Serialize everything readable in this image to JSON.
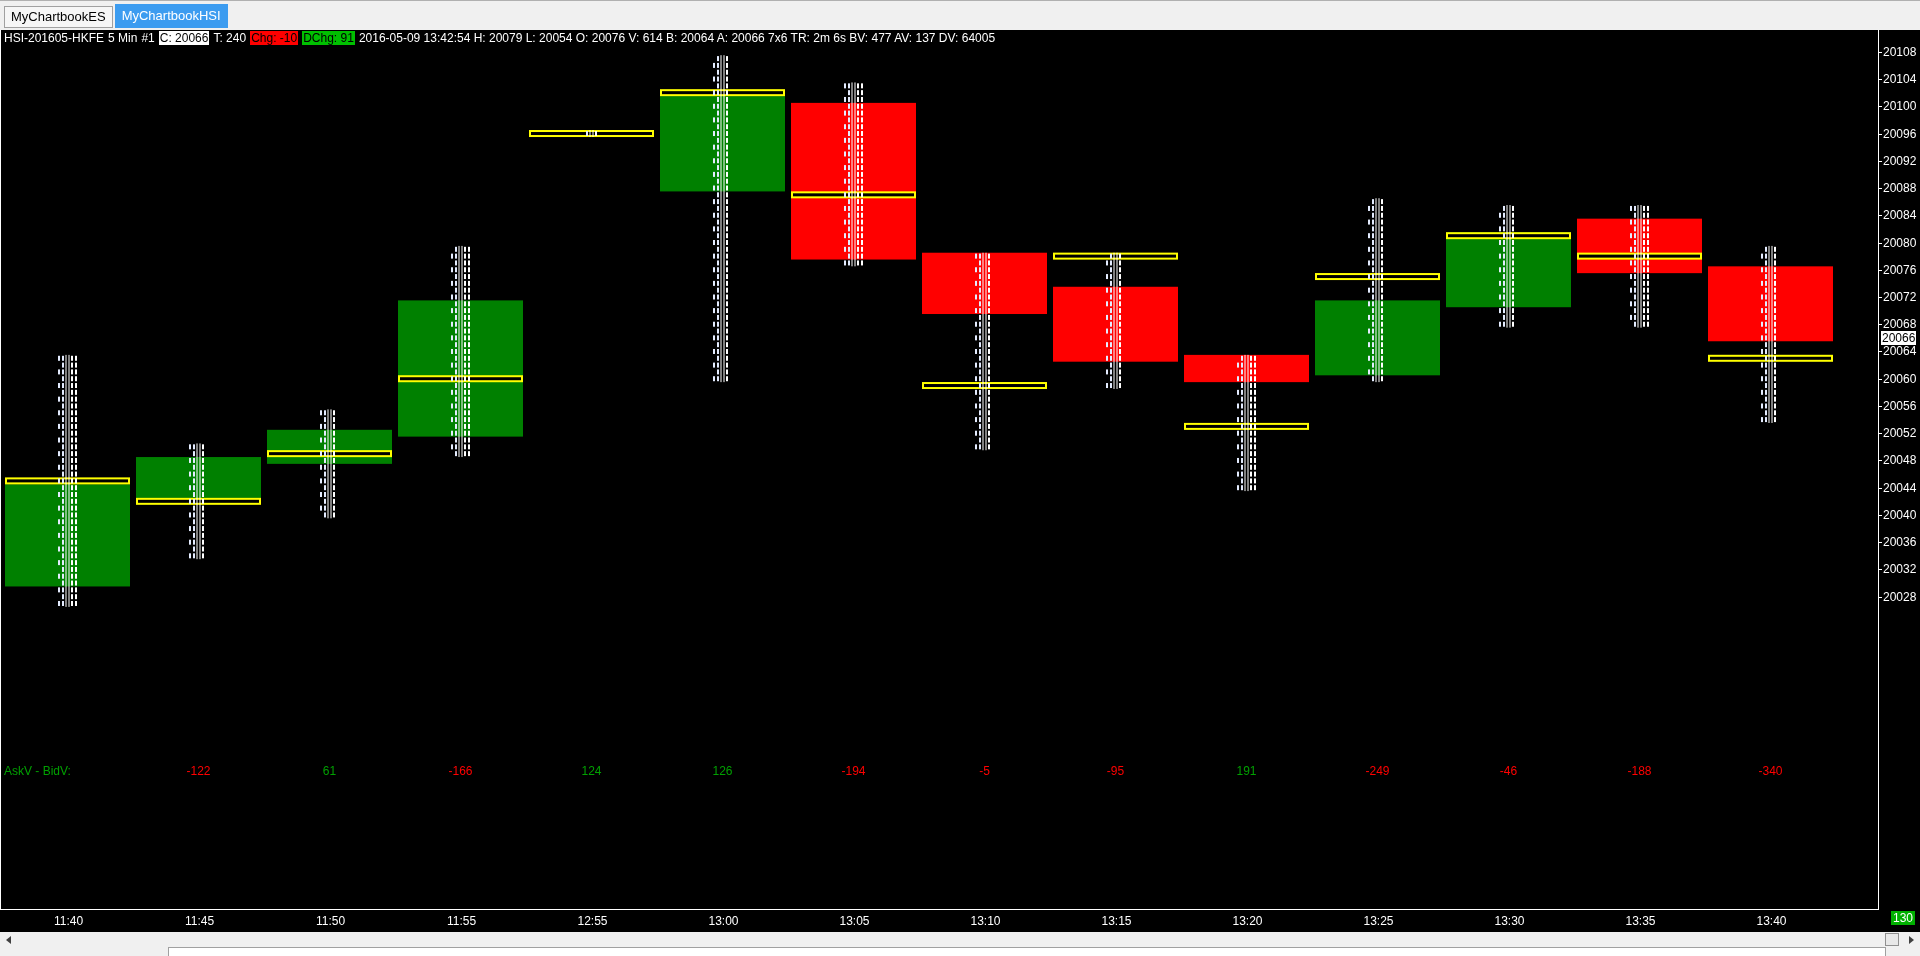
{
  "tabs": [
    {
      "label": "MyChartbookES",
      "selected": false
    },
    {
      "label": "MyChartbookHSI",
      "selected": true
    }
  ],
  "header": [
    {
      "text": "HSI-201605-HKFE"
    },
    {
      "text": "5 Min"
    },
    {
      "text": "#1"
    },
    {
      "text": "C: 20066",
      "color": "#ffffff"
    },
    {
      "text": "T: 240"
    },
    {
      "text": "Chg: -10",
      "color": "#ff0000"
    },
    {
      "text": "DChg: 91",
      "color": "#00c000"
    },
    {
      "text": "2016-05-09 13:42:54 H: 20079 L: 20054 O: 20076 V: 614 B: 20064 A: 20066 7x6 TR: 2m 6s BV: 477 AV: 137 DV: 64005"
    }
  ],
  "chart": {
    "price_labels": [
      "20108",
      "20104",
      "20100",
      "20096",
      "20092",
      "20088",
      "20084",
      "20080",
      "20076",
      "20072",
      "20068",
      "20064",
      "20060",
      "20056",
      "20052",
      "20048",
      "20044",
      "20040",
      "20036",
      "20032",
      "20028"
    ],
    "current_price": "20066",
    "delta_row": {
      "label": "AskV - BidV:",
      "values": [
        {
          "text": "-122",
          "color": "#ff0000"
        },
        {
          "text": "61",
          "color": "#00a000"
        },
        {
          "text": "-166",
          "color": "#ff0000"
        },
        {
          "text": "124",
          "color": "#00a000"
        },
        {
          "text": "126",
          "color": "#00a000"
        },
        {
          "text": "-194",
          "color": "#ff0000"
        },
        {
          "text": "-5",
          "color": "#ff0000"
        },
        {
          "text": "-95",
          "color": "#ff0000"
        },
        {
          "text": "191",
          "color": "#00a000"
        },
        {
          "text": "-249",
          "color": "#ff0000"
        },
        {
          "text": "-46",
          "color": "#ff0000"
        },
        {
          "text": "-188",
          "color": "#ff0000"
        },
        {
          "text": "-340",
          "color": "#ff0000"
        }
      ]
    },
    "time_labels": [
      "11:40",
      "11:45",
      "11:50",
      "11:55",
      "12:55",
      "13:00",
      "13:05",
      "13:10",
      "13:15",
      "13:20",
      "13:25",
      "13:30",
      "13:35",
      "13:40"
    ],
    "corner_badge": "130"
  }
}
